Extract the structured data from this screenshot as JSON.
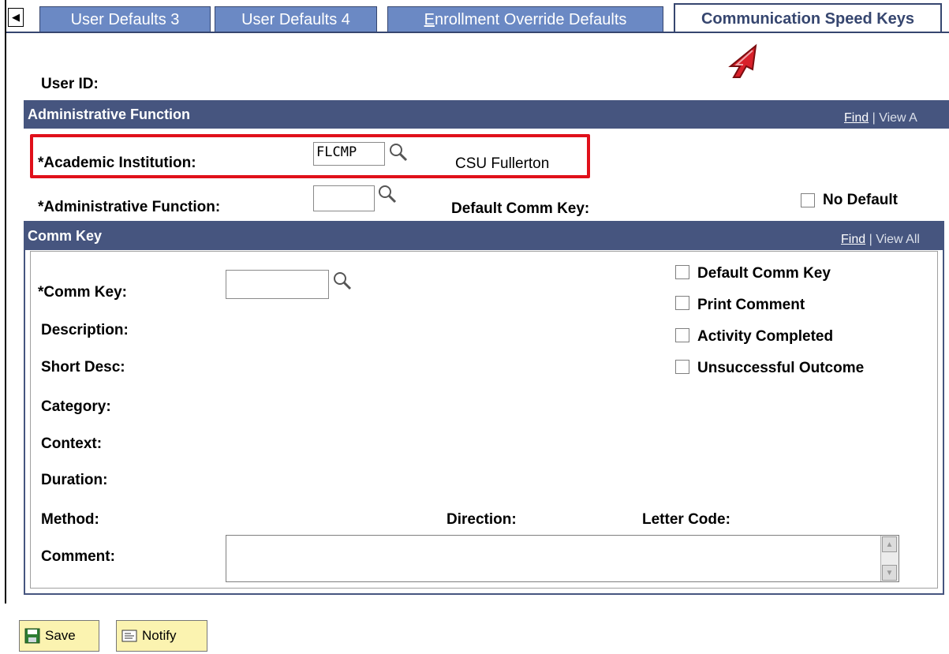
{
  "tabs": {
    "scroll_icon": "left-arrow-icon",
    "items": [
      {
        "label": "User Defaults 3"
      },
      {
        "label": "User Defaults 4"
      },
      {
        "label_prefix": "E",
        "label_rest": "nrollment Override Defaults"
      },
      {
        "label": "Communication Speed Keys",
        "active": true
      }
    ]
  },
  "user_id": {
    "label": "User ID:"
  },
  "admin_section": {
    "title": "Administrative Function",
    "find": "Find",
    "separator": "|",
    "view": "View A",
    "institution_label": "*Academic Institution:",
    "institution_value": "FLCMP",
    "institution_desc": "CSU Fullerton",
    "function_label": "*Administrative Function:",
    "function_value": "",
    "default_comm_key_label": "Default Comm Key:",
    "no_default_label": "No Default"
  },
  "comm_section": {
    "title": "Comm Key",
    "find": "Find",
    "separator": "|",
    "view": "View All",
    "comm_key_label": "*Comm Key:",
    "comm_key_value": "",
    "description_label": "Description:",
    "short_desc_label": "Short Desc:",
    "category_label": "Category:",
    "context_label": "Context:",
    "duration_label": "Duration:",
    "method_label": "Method:",
    "direction_label": "Direction:",
    "letter_code_label": "Letter Code:",
    "comment_label": "Comment:",
    "checkboxes": [
      {
        "label": "Default Comm Key"
      },
      {
        "label": "Print Comment"
      },
      {
        "label": "Activity Completed"
      },
      {
        "label": "Unsuccessful Outcome"
      }
    ]
  },
  "buttons": {
    "save": "Save",
    "notify": "Notify"
  },
  "colors": {
    "tab_bg": "#6b89c4",
    "band_bg": "#46557f",
    "highlight": "#e0101a",
    "button_bg": "#fbf3b0"
  }
}
